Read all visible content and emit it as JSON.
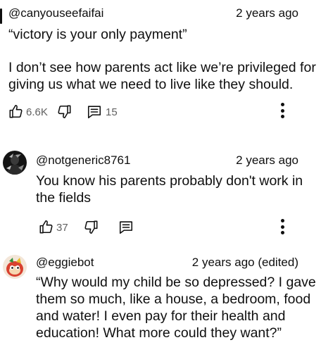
{
  "comments": [
    {
      "author": "@canyouseefaifai",
      "time": "2 years ago",
      "line1": "“victory is your only payment”",
      "line2": "I don’t see how parents act like we’re privileged for",
      "line3": "giving us what we need to live like they should.",
      "likes": "6.6K",
      "replies": "15"
    },
    {
      "author": "@notgeneric8761",
      "time": "2 years ago",
      "line1": "You know his parents probably don't work in",
      "line2": "the fields",
      "likes": "37"
    },
    {
      "author": "@eggiebot",
      "time": "2 years ago (edited)",
      "line1": "“Why would my child be so depressed? I gave",
      "line2": "them so much, like a house, a bedroom, food",
      "line3": "and water! I even pay for their health and",
      "line4": "education! What more could they want?”"
    }
  ]
}
